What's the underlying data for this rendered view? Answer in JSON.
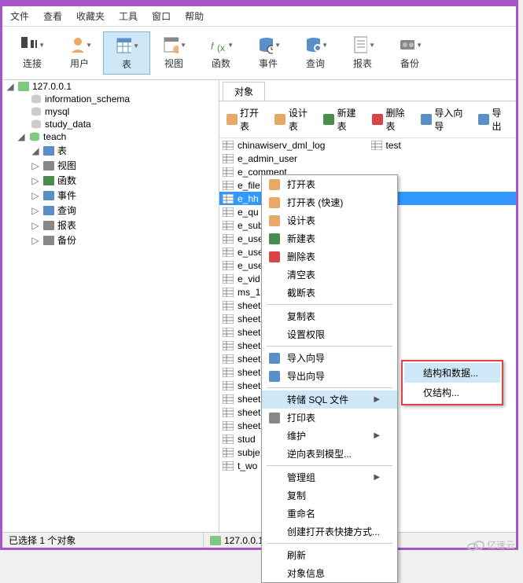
{
  "menu": [
    "文件",
    "查看",
    "收藏夹",
    "工具",
    "窗口",
    "帮助"
  ],
  "tools": [
    {
      "name": "connect",
      "label": "连接"
    },
    {
      "name": "user",
      "label": "用户"
    },
    {
      "name": "table",
      "label": "表",
      "active": true
    },
    {
      "name": "view",
      "label": "视图"
    },
    {
      "name": "func",
      "label": "函数"
    },
    {
      "name": "event",
      "label": "事件"
    },
    {
      "name": "query",
      "label": "查询"
    },
    {
      "name": "report",
      "label": "报表"
    },
    {
      "name": "backup",
      "label": "备份"
    }
  ],
  "tree": {
    "conn": "127.0.0.1",
    "dbs": [
      "information_schema",
      "mysql",
      "study_data"
    ],
    "open_db": "teach",
    "children": [
      {
        "label": "表",
        "icon": "tbl"
      },
      {
        "label": "视图",
        "icon": "view"
      },
      {
        "label": "函数",
        "icon": "fn"
      },
      {
        "label": "事件",
        "icon": "evt"
      },
      {
        "label": "查询",
        "icon": "qry"
      },
      {
        "label": "报表",
        "icon": "rpt"
      },
      {
        "label": "备份",
        "icon": "bak"
      }
    ]
  },
  "tab": "对象",
  "actions": [
    "打开表",
    "设计表",
    "新建表",
    "删除表",
    "导入向导",
    "导出"
  ],
  "top_tables": [
    "chinawiserv_dml_log",
    "test"
  ],
  "tables": [
    "e_admin_user",
    "e_comment",
    "e_file",
    "e_hh",
    "e_qu",
    "e_sub",
    "e_use",
    "e_use",
    "e_use",
    "e_vid",
    "ms_1",
    "sheet",
    "sheet",
    "sheet",
    "sheet",
    "sheet",
    "sheet",
    "sheet",
    "sheet",
    "sheet",
    "sheet",
    "stud",
    "subje",
    "t_wo"
  ],
  "selected_table_index": 3,
  "ctx": [
    {
      "t": "打开表",
      "i": "open"
    },
    {
      "t": "打开表 (快速)",
      "i": "open"
    },
    {
      "t": "设计表",
      "i": "design"
    },
    {
      "t": "新建表",
      "i": "new"
    },
    {
      "t": "删除表",
      "i": "del"
    },
    {
      "t": "清空表"
    },
    {
      "t": "截断表"
    },
    {
      "sep": 1
    },
    {
      "t": "复制表"
    },
    {
      "t": "设置权限"
    },
    {
      "sep": 1
    },
    {
      "t": "导入向导",
      "i": "imp"
    },
    {
      "t": "导出向导",
      "i": "exp"
    },
    {
      "sep": 1
    },
    {
      "t": "转储 SQL 文件",
      "arrow": 1,
      "hl": 1
    },
    {
      "t": "打印表",
      "i": "print"
    },
    {
      "t": "维护",
      "arrow": 1
    },
    {
      "t": "逆向表到模型..."
    },
    {
      "sep": 1
    },
    {
      "t": "管理组",
      "arrow": 1
    },
    {
      "t": "复制"
    },
    {
      "t": "重命名"
    },
    {
      "t": "创建打开表快捷方式..."
    },
    {
      "sep": 1
    },
    {
      "t": "刷新"
    },
    {
      "t": "对象信息"
    }
  ],
  "sub": [
    "结构和数据...",
    "仅结构..."
  ],
  "status": {
    "sel": "已选择 1 个对象",
    "conn": "127.0.0.1"
  },
  "watermark": "亿速云"
}
